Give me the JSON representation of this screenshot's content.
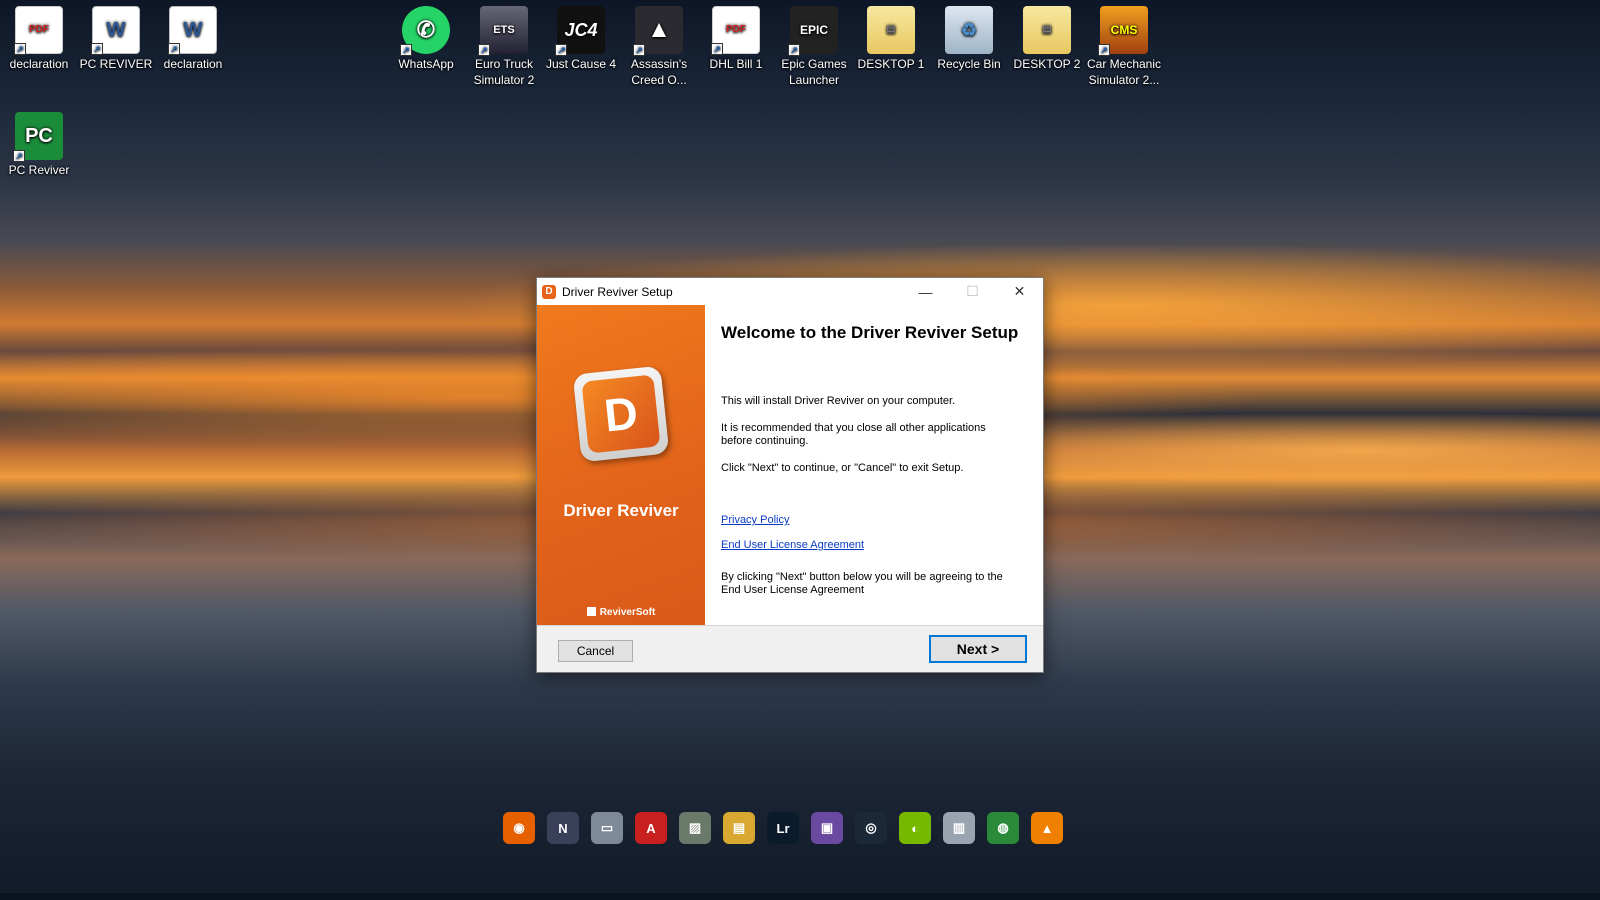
{
  "desktop": {
    "icons": [
      {
        "label": "declaration",
        "glyph": "PDF"
      },
      {
        "label": "PC REVIVER",
        "glyph": "W"
      },
      {
        "label": "declaration",
        "glyph": "W"
      },
      {
        "label": "WhatsApp",
        "glyph": "✆"
      },
      {
        "label": "Euro Truck Simulator 2",
        "glyph": "ETS"
      },
      {
        "label": "Just Cause 4",
        "glyph": "JC4"
      },
      {
        "label": "Assassin's Creed O...",
        "glyph": "▲"
      },
      {
        "label": "DHL Bill 1",
        "glyph": "PDF"
      },
      {
        "label": "Epic Games Launcher",
        "glyph": "EPIC"
      },
      {
        "label": "DESKTOP 1",
        "glyph": "▤"
      },
      {
        "label": "Recycle Bin",
        "glyph": "♻"
      },
      {
        "label": "DESKTOP 2",
        "glyph": "▤"
      },
      {
        "label": "Car Mechanic Simulator 2...",
        "glyph": "CMS"
      },
      {
        "label": "PC Reviver",
        "glyph": "PC"
      }
    ],
    "shortcut_glyph": "↗"
  },
  "dialog": {
    "title": "Driver Reviver Setup",
    "controls": {
      "minimize": "—",
      "maximize": "☐",
      "close": "✕"
    },
    "app_icon_glyph": "D",
    "logo_glyph": "D",
    "brand_name": "Driver Reviver",
    "vendor": "ReviverSoft",
    "heading": "Welcome to the Driver Reviver Setup",
    "text_install": "This will install Driver Reviver on your computer.",
    "text_recommend": "It is recommended that you close all other applications before continuing.",
    "text_click": "Click \"Next\" to continue, or \"Cancel\" to exit Setup.",
    "link_privacy": "Privacy Policy",
    "link_eula": "End User License Agreement",
    "text_agree": "By clicking \"Next\" button below you will be agreeing to the End User License Agreement",
    "cancel_label": "Cancel",
    "next_label": "Next >"
  },
  "dock": {
    "items": [
      {
        "name": "firefox-icon",
        "glyph": "◉",
        "color": "#e66000"
      },
      {
        "name": "nexus-icon",
        "glyph": "N",
        "color": "#3a3f5a"
      },
      {
        "name": "drive-icon",
        "glyph": "▭",
        "color": "#7f8a99"
      },
      {
        "name": "acrobat-icon",
        "glyph": "A",
        "color": "#c8201e"
      },
      {
        "name": "image-viewer-icon",
        "glyph": "▨",
        "color": "#6a7a6a"
      },
      {
        "name": "folder-tree-icon",
        "glyph": "▤",
        "color": "#d8a830"
      },
      {
        "name": "lightroom-icon",
        "glyph": "Lr",
        "color": "#0b1b2b"
      },
      {
        "name": "monitor-icon",
        "glyph": "▣",
        "color": "#6a4aa0"
      },
      {
        "name": "steam-icon",
        "glyph": "◎",
        "color": "#1b2838"
      },
      {
        "name": "nvidia-icon",
        "glyph": "◐",
        "color": "#76b900"
      },
      {
        "name": "trash-icon",
        "glyph": "▥",
        "color": "#9aa4b0"
      },
      {
        "name": "chrome-icon",
        "glyph": "◍",
        "color": "#2a8a3a"
      },
      {
        "name": "vlc-icon",
        "glyph": "▲",
        "color": "#f08000"
      }
    ]
  }
}
